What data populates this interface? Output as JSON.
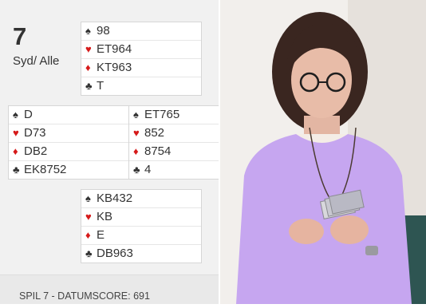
{
  "board": {
    "number": "7",
    "dealer_vul": "Syd/ Alle"
  },
  "hands": {
    "north": [
      {
        "suit": "spade-icon",
        "glyph": "♠",
        "color": "black",
        "cards": "98"
      },
      {
        "suit": "heart-icon",
        "glyph": "♥",
        "color": "red",
        "cards": "ET964"
      },
      {
        "suit": "diamond-icon",
        "glyph": "♦",
        "color": "red",
        "cards": "KT963"
      },
      {
        "suit": "club-icon",
        "glyph": "♣",
        "color": "black",
        "cards": "T"
      }
    ],
    "west": [
      {
        "suit": "spade-icon",
        "glyph": "♠",
        "color": "black",
        "cards": "D"
      },
      {
        "suit": "heart-icon",
        "glyph": "♥",
        "color": "red",
        "cards": "D73"
      },
      {
        "suit": "diamond-icon",
        "glyph": "♦",
        "color": "red",
        "cards": "DB2"
      },
      {
        "suit": "club-icon",
        "glyph": "♣",
        "color": "black",
        "cards": "EK8752"
      }
    ],
    "east": [
      {
        "suit": "spade-icon",
        "glyph": "♠",
        "color": "black",
        "cards": "ET765"
      },
      {
        "suit": "heart-icon",
        "glyph": "♥",
        "color": "red",
        "cards": "852"
      },
      {
        "suit": "diamond-icon",
        "glyph": "♦",
        "color": "red",
        "cards": "8754"
      },
      {
        "suit": "club-icon",
        "glyph": "♣",
        "color": "black",
        "cards": "4"
      }
    ],
    "south": [
      {
        "suit": "spade-icon",
        "glyph": "♠",
        "color": "black",
        "cards": "KB432"
      },
      {
        "suit": "heart-icon",
        "glyph": "♥",
        "color": "red",
        "cards": "KB"
      },
      {
        "suit": "diamond-icon",
        "glyph": "♦",
        "color": "red",
        "cards": "E"
      },
      {
        "suit": "club-icon",
        "glyph": "♣",
        "color": "black",
        "cards": "DB963"
      }
    ]
  },
  "footer": {
    "text": "SPIL 7 - DATUMSCORE: 691"
  },
  "colors": {
    "red_suit": "#d61a1a",
    "black_suit": "#333333",
    "panel_bg": "#f1f1f1"
  }
}
